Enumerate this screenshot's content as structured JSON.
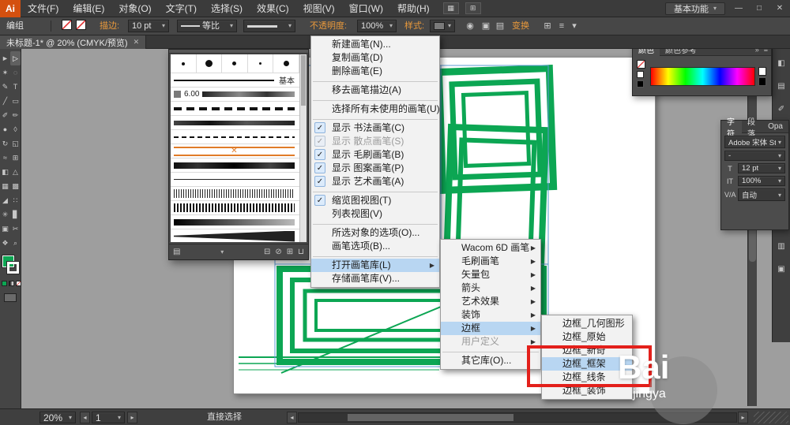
{
  "window": {
    "logo": "Ai",
    "workspace_label": "基本功能"
  },
  "icons": {
    "close": "✕",
    "minimize": "—",
    "restore": "□",
    "chevron_down": "▾",
    "scroll_left": "◂",
    "scroll_right": "▸",
    "collapse": "»",
    "panel_menu": "≡",
    "arrange_documents": "▦",
    "document_layout": "⊞",
    "recolor": "◉",
    "doc_setup": "▣",
    "preferences": "▤",
    "libraries": "▤",
    "library_panel": "⊟",
    "remove_stroke": "⊘",
    "new_brush": "⊞",
    "delete_brush": "⊔",
    "x_mark": "✕"
  },
  "menubar": [
    "文件(F)",
    "编辑(E)",
    "对象(O)",
    "文字(T)",
    "选择(S)",
    "效果(C)",
    "视图(V)",
    "窗口(W)",
    "帮助(H)"
  ],
  "control_bar": {
    "object_label": "编组",
    "stroke_label": "描边:",
    "stroke_value": "10 pt",
    "profile_value": "等比",
    "opacity_label": "不透明度:",
    "opacity_value": "100%",
    "style_label": "样式:",
    "transform_label": "变换"
  },
  "doc_tab": {
    "title": "未标题-1* @ 20% (CMYK/预览)"
  },
  "tools": [
    {
      "name": "selection-tool",
      "glyph": "►",
      "state": ""
    },
    {
      "name": "direct-selection-tool",
      "glyph": "▷",
      "state": "active"
    },
    {
      "name": "magic-wand-tool",
      "glyph": "✶",
      "state": ""
    },
    {
      "name": "lasso-tool",
      "glyph": "◌",
      "state": ""
    },
    {
      "name": "pen-tool",
      "glyph": "✎",
      "state": ""
    },
    {
      "name": "type-tool",
      "glyph": "T",
      "state": ""
    },
    {
      "name": "line-tool",
      "glyph": "╱",
      "state": ""
    },
    {
      "name": "rectangle-tool",
      "glyph": "▭",
      "state": ""
    },
    {
      "name": "paintbrush-tool",
      "glyph": "✐",
      "state": ""
    },
    {
      "name": "pencil-tool",
      "glyph": "✏",
      "state": ""
    },
    {
      "name": "blob-brush-tool",
      "glyph": "●",
      "state": ""
    },
    {
      "name": "eraser-tool",
      "glyph": "◊",
      "state": ""
    },
    {
      "name": "rotate-tool",
      "glyph": "↻",
      "state": ""
    },
    {
      "name": "scale-tool",
      "glyph": "◱",
      "state": ""
    },
    {
      "name": "width-tool",
      "glyph": "≈",
      "state": ""
    },
    {
      "name": "free-transform-tool",
      "glyph": "⊞",
      "state": ""
    },
    {
      "name": "shape-builder-tool",
      "glyph": "◧",
      "state": ""
    },
    {
      "name": "perspective-grid-tool",
      "glyph": "△",
      "state": ""
    },
    {
      "name": "mesh-tool",
      "glyph": "▦",
      "state": ""
    },
    {
      "name": "gradient-tool",
      "glyph": "▩",
      "state": ""
    },
    {
      "name": "eyedropper-tool",
      "glyph": "◢",
      "state": ""
    },
    {
      "name": "blend-tool",
      "glyph": "∷",
      "state": ""
    },
    {
      "name": "symbol-sprayer-tool",
      "glyph": "✳",
      "state": ""
    },
    {
      "name": "graph-tool",
      "glyph": "▊",
      "state": ""
    },
    {
      "name": "artboard-tool",
      "glyph": "▣",
      "state": ""
    },
    {
      "name": "slice-tool",
      "glyph": "✂",
      "state": ""
    },
    {
      "name": "hand-tool",
      "glyph": "❖",
      "state": ""
    },
    {
      "name": "zoom-tool",
      "glyph": "⌕",
      "state": ""
    }
  ],
  "brushes_panel": {
    "basic_brush_label": "基本",
    "size_brush_label": "6.00"
  },
  "brush_menu": {
    "items": [
      {
        "label": "新建画笔(N)...",
        "state": ""
      },
      {
        "label": "复制画笔(D)",
        "state": ""
      },
      {
        "label": "删除画笔(E)",
        "state": ""
      },
      {
        "label": "",
        "state": "sep"
      },
      {
        "label": "移去画笔描边(A)",
        "state": ""
      },
      {
        "label": "",
        "state": "sep"
      },
      {
        "label": "选择所有未使用的画笔(U)",
        "state": ""
      },
      {
        "label": "",
        "state": "sep"
      },
      {
        "label": "显示 书法画笔(C)",
        "state": "checked"
      },
      {
        "label": "显示 散点画笔(S)",
        "state": "checked disabled"
      },
      {
        "label": "显示 毛刷画笔(B)",
        "state": "checked"
      },
      {
        "label": "显示 图案画笔(P)",
        "state": "checked"
      },
      {
        "label": "显示 艺术画笔(A)",
        "state": "checked"
      },
      {
        "label": "",
        "state": "sep"
      },
      {
        "label": "缩览图视图(T)",
        "state": "checked"
      },
      {
        "label": "列表视图(V)",
        "state": ""
      },
      {
        "label": "",
        "state": "sep"
      },
      {
        "label": "所选对象的选项(O)...",
        "state": ""
      },
      {
        "label": "画笔选项(B)...",
        "state": ""
      },
      {
        "label": "",
        "state": "sep"
      },
      {
        "label": "打开画笔库(L)",
        "state": "has-sub hl"
      },
      {
        "label": "存储画笔库(V)...",
        "state": ""
      }
    ]
  },
  "library_menu": {
    "items": [
      {
        "label": "Wacom 6D 画笔",
        "state": "has-sub"
      },
      {
        "label": "毛刷画笔",
        "state": "has-sub"
      },
      {
        "label": "矢量包",
        "state": "has-sub"
      },
      {
        "label": "箭头",
        "state": "has-sub"
      },
      {
        "label": "艺术效果",
        "state": "has-sub"
      },
      {
        "label": "装饰",
        "state": "has-sub"
      },
      {
        "label": "边框",
        "state": "has-sub hl"
      },
      {
        "label": "用户定义",
        "state": "has-sub disabled"
      },
      {
        "label": "",
        "state": "sep"
      },
      {
        "label": "其它库(O)...",
        "state": ""
      }
    ]
  },
  "border_menu": {
    "items": [
      {
        "label": "边框_几何图形",
        "state": ""
      },
      {
        "label": "边框_原始",
        "state": ""
      },
      {
        "label": "边框_新奇",
        "state": ""
      },
      {
        "label": "边框_框架",
        "state": "hl"
      },
      {
        "label": "边框_线条",
        "state": ""
      },
      {
        "label": "边框_装饰",
        "state": ""
      }
    ]
  },
  "color_panel": {
    "tab_color": "颜色",
    "tab_guide": "颜色参考"
  },
  "char_panel": {
    "tab_character": "字符",
    "tab_paragraph": "段落",
    "tab_opentype": "Opa",
    "font_name": "Adobe 宋体 Std L",
    "font_style": "-",
    "size_icon": "T",
    "size_value": "12 pt",
    "scale_icon": "IT",
    "scale_value": "100%",
    "tracking_icon": "V/A",
    "tracking_value": "自动"
  },
  "dock_icons": [
    {
      "name": "color-panel-icon",
      "glyph": "◧"
    },
    {
      "name": "swatches-panel-icon",
      "glyph": "▤"
    },
    {
      "name": "brushes-panel-icon",
      "glyph": "✐"
    },
    {
      "name": "symbols-panel-icon",
      "glyph": "❖"
    },
    {
      "name": "stroke-panel-icon",
      "glyph": "≡"
    },
    {
      "name": "gradient-panel-icon",
      "glyph": "▩"
    },
    {
      "name": "transparency-panel-icon",
      "glyph": "◐"
    },
    {
      "name": "appearance-panel-icon",
      "glyph": "◑"
    },
    {
      "name": "layers-panel-icon",
      "glyph": "▥"
    },
    {
      "name": "artboards-panel-icon",
      "glyph": "▣"
    }
  ],
  "status_bar": {
    "zoom": "20%",
    "artboard_number": "1",
    "tool_label": "直接选择"
  },
  "watermark": {
    "line1": "Bai",
    "line2": "jingya"
  },
  "colors": {
    "artwork_green": "#0ca653",
    "annotation_red": "#e3201b",
    "accent_orange": "#e9993b",
    "menu_highlight": "#b8d6f2"
  }
}
